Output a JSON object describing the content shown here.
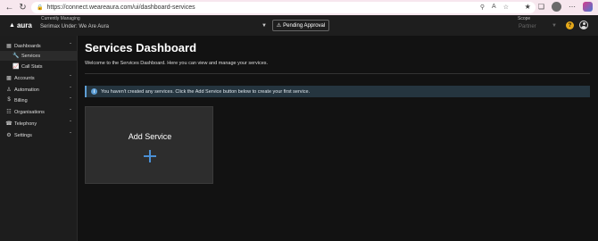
{
  "browser": {
    "url": "https://connect.weareaura.com/ui/dashboard-services",
    "back_icon": "arrow-left-icon",
    "reload_icon": "reload-icon"
  },
  "header": {
    "logo_text": "aura",
    "managing_label": "Currently Managing",
    "managing_value": "Serimax Under: We Are Aura",
    "pending_label": "Pending Approval",
    "scope_label": "Scope",
    "scope_value": "Partner"
  },
  "sidebar": {
    "items": [
      {
        "label": "Dashboards",
        "icon": "grid-icon",
        "expanded": true
      },
      {
        "label": "Services",
        "icon": "wrench-icon"
      },
      {
        "label": "Call Stats",
        "icon": "chart-icon"
      },
      {
        "label": "Accounts",
        "icon": "card-icon"
      },
      {
        "label": "Automation",
        "icon": "person-icon"
      },
      {
        "label": "Billing",
        "icon": "dollar-icon"
      },
      {
        "label": "Organisations",
        "icon": "org-icon"
      },
      {
        "label": "Telephony",
        "icon": "phone-icon"
      },
      {
        "label": "Settings",
        "icon": "gear-icon"
      }
    ]
  },
  "main": {
    "title": "Services Dashboard",
    "subtitle": "Welcome to the Services Dashboard. Here you can view and manage your services.",
    "info_message": "You haven't created any services. Click the Add Service button below to create your first service.",
    "add_card_label": "Add Service"
  },
  "colors": {
    "accent_blue": "#4a8fd4",
    "help_yellow": "#e5a81a",
    "background": "#121212",
    "browser_frame": "#eb87b5"
  }
}
